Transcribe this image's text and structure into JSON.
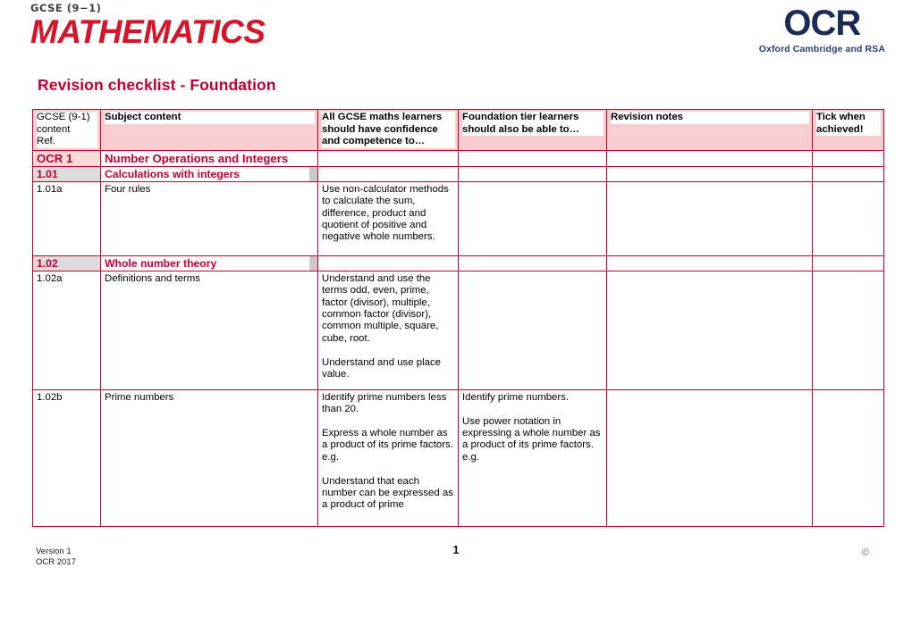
{
  "branding": {
    "gcse_kicker": "GCSE (9−1)",
    "gcse_word": "MATHEMATICS",
    "gcse_color": "#d4152a",
    "ocr_mark": "OCR",
    "ocr_strapline": "Oxford Cambridge and RSA",
    "ocr_color": "#1d2a55"
  },
  "title": "Revision checklist - Foundation",
  "title_color": "#c00030",
  "table": {
    "accent_color": "#c00030",
    "header_fill": "#f7cdd0",
    "section_minor_fill": "#dcdcdc",
    "section_major_fill": "#fbd9d6",
    "headers": {
      "ref": [
        "GCSE (9-1)",
        "content",
        "Ref."
      ],
      "subject_content": "Subject content",
      "all_learners": [
        "All GCSE maths learners",
        "should have confidence",
        "and competence to…"
      ],
      "foundation_learners": [
        "Foundation tier learners",
        "should also be able to…"
      ],
      "revision_notes": "Revision notes",
      "tick": [
        "Tick when",
        "achieved!"
      ]
    },
    "rows": [
      {
        "kind": "section-major",
        "ref": "OCR 1",
        "title": "Number Operations and Integers"
      },
      {
        "kind": "section-minor",
        "ref": "1.01",
        "title": "Calculations with integers"
      },
      {
        "kind": "content",
        "ref": "1.01a",
        "subject": "Four rules",
        "all_learners": [
          "Use non-calculator methods to calculate the sum, difference, product and quotient of positive and negative whole numbers."
        ],
        "foundation": [],
        "notes": "",
        "tick": ""
      },
      {
        "kind": "section-minor",
        "ref": "1.02",
        "title": "Whole number theory"
      },
      {
        "kind": "content",
        "ref": "1.02a",
        "subject": "Definitions and terms",
        "all_learners": [
          "Understand and use the terms odd, even, prime, factor (divisor), multiple, common factor (divisor), common multiple, square, cube, root.",
          "Understand and use place value."
        ],
        "foundation": [],
        "notes": "",
        "tick": ""
      },
      {
        "kind": "content",
        "ref": "1.02b",
        "subject": "Prime numbers",
        "all_learners": [
          "Identify prime numbers less than 20.",
          "Express a whole number as a product of its prime factors.\ne.g.",
          "Understand that each number can be expressed as a product of prime"
        ],
        "foundation": [
          "Identify prime numbers.",
          "Use power notation in expressing a whole number as a product of its prime factors.\ne.g."
        ],
        "notes": "",
        "tick": ""
      }
    ]
  },
  "footer": {
    "version": "Version 1",
    "org_year": "OCR 2017",
    "page_number": "1",
    "copyright": "©"
  }
}
